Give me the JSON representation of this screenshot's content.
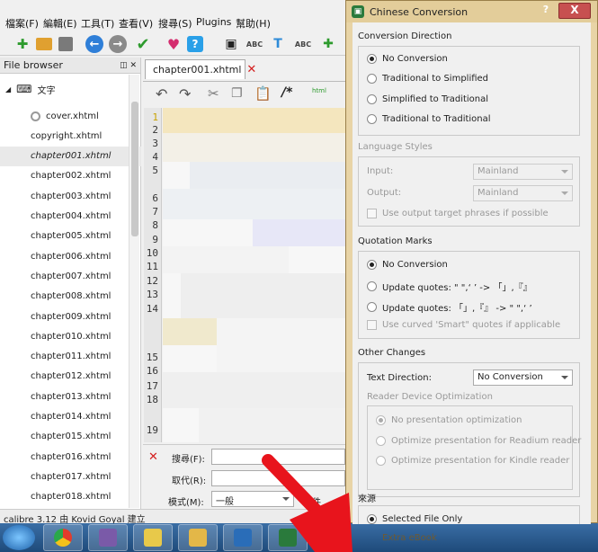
{
  "menubar": {
    "items": [
      "檔案(F)",
      "編輯(E)",
      "工具(T)",
      "查看(V)",
      "搜尋(S)",
      "Plugins",
      "幫助(H)"
    ]
  },
  "filebrowser": {
    "title": "File browser",
    "root": "文字",
    "files": [
      "cover.xhtml",
      "copyright.xhtml",
      "chapter001.xhtml",
      "chapter002.xhtml",
      "chapter003.xhtml",
      "chapter004.xhtml",
      "chapter005.xhtml",
      "chapter006.xhtml",
      "chapter007.xhtml",
      "chapter008.xhtml",
      "chapter009.xhtml",
      "chapter010.xhtml",
      "chapter011.xhtml",
      "chapter012.xhtml",
      "chapter013.xhtml",
      "chapter014.xhtml",
      "chapter015.xhtml",
      "chapter016.xhtml",
      "chapter017.xhtml",
      "chapter018.xhtml"
    ],
    "selected_index": 2
  },
  "editor": {
    "tab_label": "chapter001.xhtml",
    "line_numbers": [
      "1",
      "2",
      "3",
      "4",
      "5",
      "6",
      "7",
      "8",
      "9",
      "10",
      "11",
      "12",
      "13",
      "14",
      "15",
      "16",
      "17",
      "18",
      "19"
    ]
  },
  "search": {
    "find_label": "搜尋(F):",
    "replace_label": "取代(R):",
    "mode_label": "模式(M):",
    "mode_value": "一般",
    "truncated_label": "文件"
  },
  "statusbar": {
    "text": "calibre 3.12 由 Kovid Goyal 建立"
  },
  "taskbar": {
    "faded_text": "Extra eBook"
  },
  "dialog": {
    "title": "Chinese Conversion",
    "help_label": "?",
    "close_label": "X",
    "direction": {
      "title": "Conversion Direction",
      "options": [
        "No Conversion",
        "Traditional to Simplified",
        "Simplified to Traditional",
        "Traditional to Traditional"
      ],
      "selected": 0
    },
    "language": {
      "title": "Language Styles",
      "input_label": "Input:",
      "input_value": "Mainland",
      "output_label": "Output:",
      "output_value": "Mainland",
      "checkbox_label": "Use output target phrases if possible"
    },
    "quotes": {
      "title": "Quotation Marks",
      "options": [
        "No Conversion",
        "Update quotes: \" \",‘ ’ -> 「」,『』",
        "Update quotes: 「」,『』 -> \" \",‘ ’"
      ],
      "selected": 0,
      "checkbox_label": "Use curved 'Smart\" quotes if applicable"
    },
    "other": {
      "title": "Other Changes",
      "text_direction_label": "Text Direction:",
      "text_direction_value": "No Conversion",
      "reader_title": "Reader Device Optimization",
      "reader_options": [
        "No presentation optimization",
        "Optimize presentation for Readium reader",
        "Optimize presentation for Kindle reader"
      ],
      "reader_selected": 0
    },
    "source": {
      "title": "來源",
      "option": "Selected File Only"
    }
  }
}
